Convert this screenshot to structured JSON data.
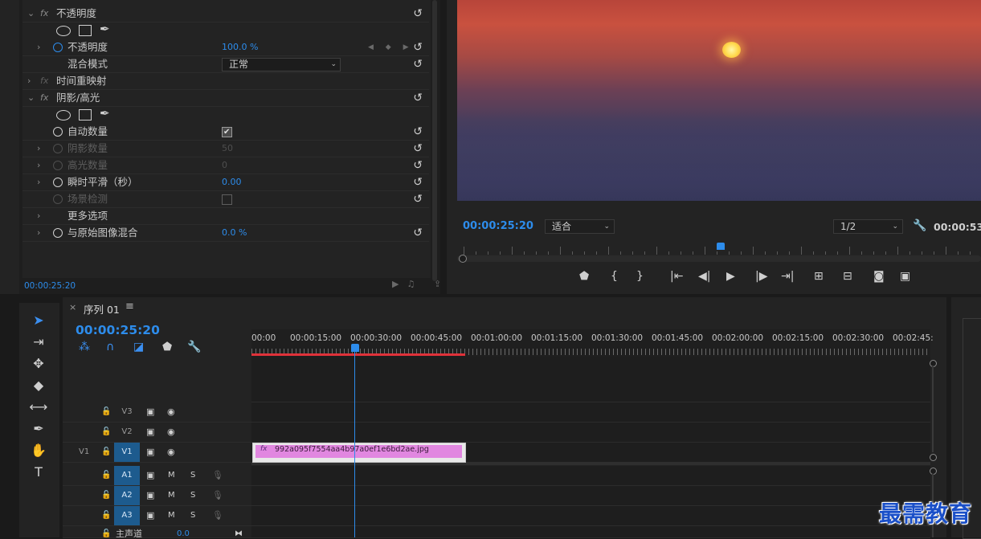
{
  "effect_controls": {
    "top_cut_label": "",
    "opacity": {
      "header": "不透明度",
      "opacity_label": "不透明度",
      "opacity_value": "100.0 %",
      "blend_label": "混合模式",
      "blend_value": "正常"
    },
    "time_remap": {
      "label": "时间重映射"
    },
    "shadow_highlight": {
      "header": "阴影/高光",
      "auto_amount_label": "自动数量",
      "auto_amount_checked": true,
      "shadow_amount_label": "阴影数量",
      "shadow_amount_value": "50",
      "highlight_amount_label": "高光数量",
      "highlight_amount_value": "0",
      "temporal_smooth_label": "瞬时平滑（秒）",
      "temporal_smooth_value": "0.00",
      "scene_detect_label": "场景检测",
      "more_options_label": "更多选项",
      "blend_original_label": "与原始图像混合",
      "blend_original_value": "0.0 %"
    },
    "fx_label": "fx",
    "timecode": "00:00:25:20"
  },
  "program_monitor": {
    "timecode": "00:00:25:20",
    "fit_label": "适合",
    "resolution_label": "1/2",
    "duration_timecode": "00:00:53:"
  },
  "timeline": {
    "sequence_tab": "序列 01",
    "close_glyph": "×",
    "menu_glyph": "≡",
    "timecode": "00:00:25:20",
    "ruler_labels": [
      "00:00",
      "00:00:15:00",
      "00:00:30:00",
      "00:00:45:00",
      "00:01:00:00",
      "00:01:15:00",
      "00:01:30:00",
      "00:01:45:00",
      "00:02:00:00",
      "00:02:15:00",
      "00:02:30:00",
      "00:02:45:"
    ],
    "tracks": {
      "v3": "V3",
      "v2": "V2",
      "v1": "V1",
      "v1_outer": "V1",
      "a1": "A1",
      "a2": "A2",
      "a3": "A3",
      "mute": "M",
      "solo": "S",
      "master_label": "主声道",
      "master_value": "0.0"
    },
    "clip": {
      "fx": "fx",
      "name": "992a095f7554aa4b97a0ef1e6bd2ae.jpg"
    }
  },
  "watermark": "最需教育",
  "colors": {
    "accent_blue": "#2d8ceb",
    "work_area_red": "#e0323a",
    "clip_pink": "#e187e0",
    "active_track_blue": "#1d5b8e"
  },
  "icons": [
    "stopwatch-icon",
    "reset-icon",
    "ellipse-mask-icon",
    "rect-mask-icon",
    "pen-mask-icon",
    "chevron-right-icon",
    "wrench-icon",
    "selection-tool-icon",
    "track-select-tool-icon",
    "ripple-edit-tool-icon",
    "razor-tool-icon",
    "slip-tool-icon",
    "pen-tool-icon",
    "hand-tool-icon",
    "type-tool-icon",
    "lock-icon",
    "eye-icon",
    "film-icon",
    "mic-icon",
    "marker-icon",
    "play-icon",
    "camera-icon"
  ]
}
